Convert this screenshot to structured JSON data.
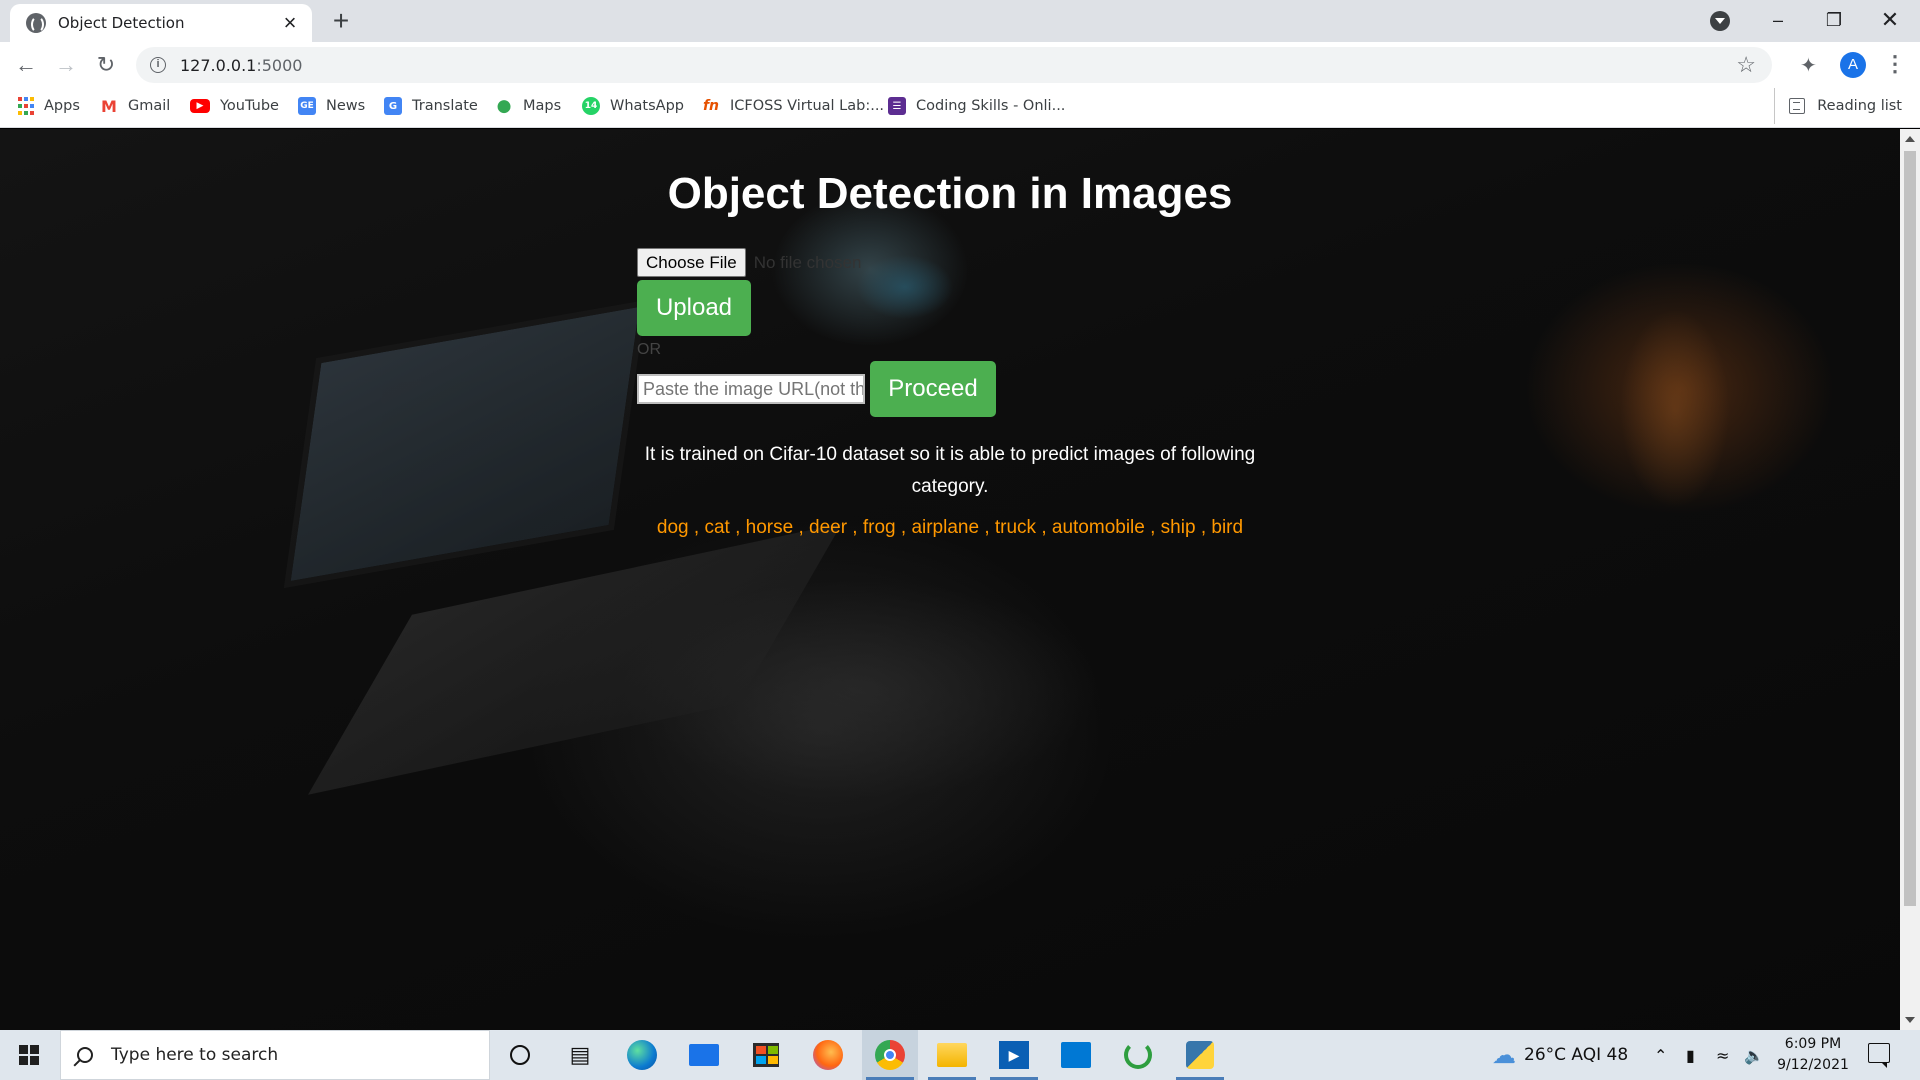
{
  "browser": {
    "tab_title": "Object Detection",
    "url_host": "127.0.0.1",
    "url_port": ":5000",
    "avatar_letter": "A",
    "bookmarks": [
      "Apps",
      "Gmail",
      "YouTube",
      "News",
      "Translate",
      "Maps",
      "WhatsApp",
      "ICFOSS Virtual Lab:...",
      "Coding Skills - Onli..."
    ],
    "reading_list": "Reading list"
  },
  "page": {
    "heading": "Object Detection in Images",
    "choose_file_label": "Choose File",
    "no_file_label": "No file chosen",
    "upload_label": "Upload",
    "or_label": "OR",
    "url_placeholder": "Paste the image URL(not the",
    "proceed_label": "Proceed",
    "info_text": "It is trained on Cifar-10 dataset so it is able to predict images of following category.",
    "categories": "dog , cat , horse , deer , frog , airplane , truck , automobile , ship , bird",
    "category_color": "#ff9800",
    "button_color": "#4caf50"
  },
  "taskbar": {
    "search_placeholder": "Type here to search",
    "weather": "26°C  AQI 48",
    "time": "6:09 PM",
    "date": "9/12/2021",
    "apps": [
      "cortana-icon",
      "task-view-icon",
      "edge-icon",
      "mail-icon",
      "store-icon",
      "firefox-icon",
      "chrome-icon",
      "file-explorer-icon",
      "video-editor-icon",
      "outlook-icon",
      "spinner-app-icon",
      "python-idle-icon"
    ]
  }
}
